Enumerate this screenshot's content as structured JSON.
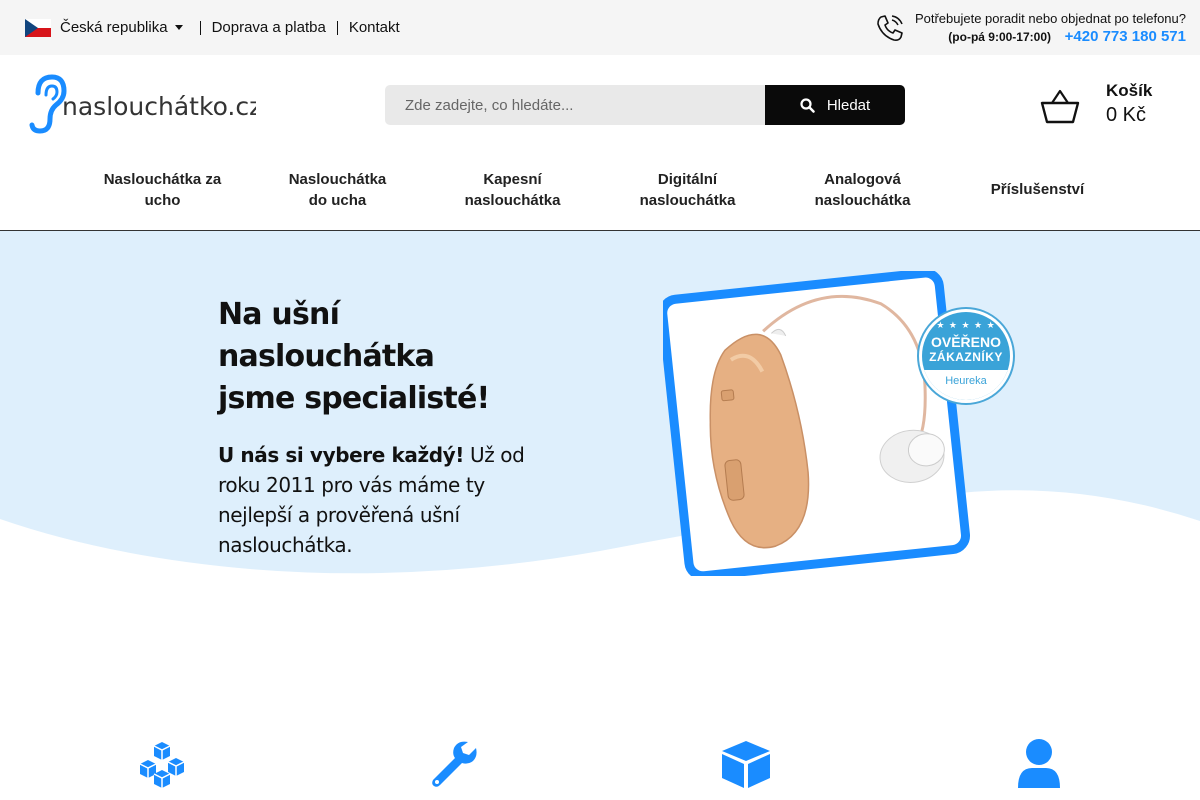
{
  "topbar": {
    "country": "Česká republika",
    "links": [
      "Doprava a platba",
      "Kontakt"
    ],
    "phone_question": "Potřebujete poradit nebo objednat po telefonu?",
    "phone_hours": "(po-pá 9:00-17:00)",
    "phone_number": "+420 773 180 571"
  },
  "header": {
    "logo_text": "naslouchátko.cz",
    "search_placeholder": "Zde zadejte, co hledáte...",
    "search_button": "Hledat",
    "cart_title": "Košík",
    "cart_total": "0 Kč"
  },
  "nav": {
    "items": [
      [
        "Naslouchátka za",
        "ucho"
      ],
      [
        "Naslouchátka",
        "do ucha"
      ],
      [
        "Kapesní",
        "naslouchátka"
      ],
      [
        "Digitální",
        "naslouchátka"
      ],
      [
        "Analogová",
        "naslouchátka"
      ],
      [
        "Příslušenství"
      ]
    ]
  },
  "hero": {
    "title_line1": "Na ušní naslouchátka",
    "title_line2": "jsme specialisté!",
    "body_bold": "U nás si vybere každý!",
    "body_rest": " Už od roku 2011 pro vás máme ty nejlepší a prověřená ušní naslouchátka.",
    "badge_line1": "OVĚŘENO",
    "badge_line2": "ZÁKAZNÍKY",
    "badge_brand": "Heureka"
  },
  "features": {
    "icons": [
      "cubes-icon",
      "wrench-icon",
      "box-icon",
      "user-icon"
    ]
  },
  "colors": {
    "accent": "#1a8cff",
    "hero_bg": "#deeffc",
    "frame": "#1a8cff"
  }
}
